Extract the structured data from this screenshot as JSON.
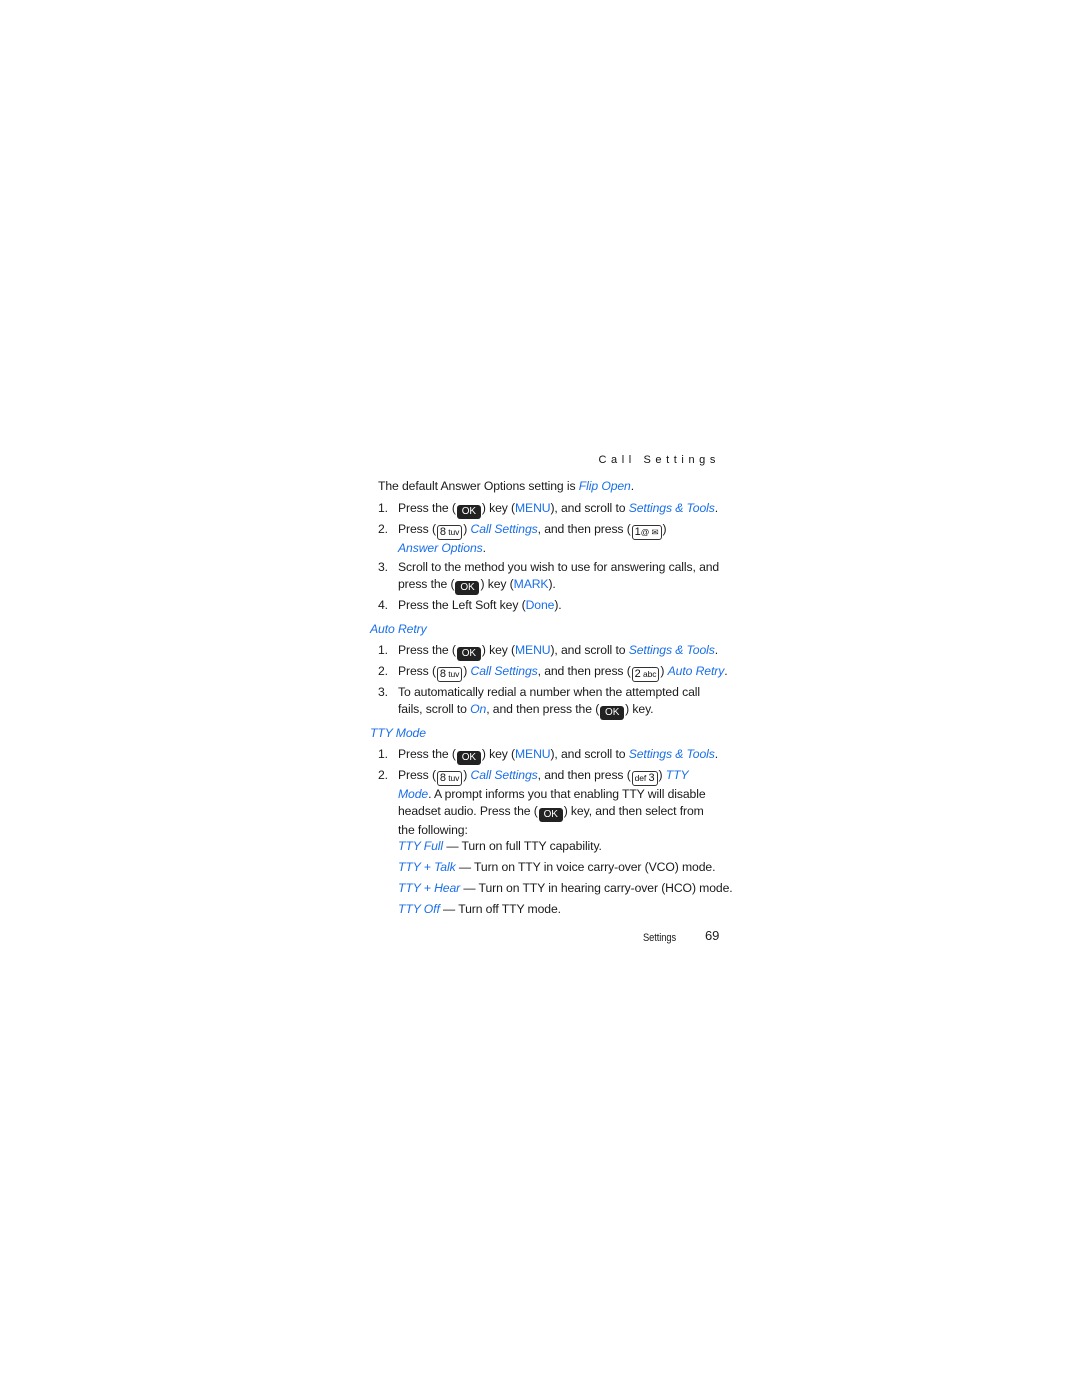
{
  "running_head": "Call Settings",
  "intro": {
    "text": "The default Answer Options setting is ",
    "value": "Flip Open",
    "end": "."
  },
  "keys": {
    "ok": "OK",
    "key8": {
      "digit": "8",
      "letters": "tuv"
    },
    "key1": {
      "digit": "1",
      "letters": "@ ✉"
    },
    "key2": {
      "digit": "2",
      "letters": "abc"
    },
    "key3": {
      "digit": "3",
      "letters": "def"
    }
  },
  "answer_steps": {
    "s1": {
      "num": "1.",
      "a": "Press the (",
      "b": ") key (",
      "menu": "MENU",
      "c": "), and scroll to ",
      "target": "Settings & Tools",
      "d": "."
    },
    "s2": {
      "num": "2.",
      "a": "Press (",
      "b": ") ",
      "link": "Call Settings",
      "c": ", and then press (",
      "d": ")",
      "target": "Answer Options",
      "e": "."
    },
    "s3": {
      "num": "3.",
      "a": "Scroll to the method you wish to use for answering calls, and press the (",
      "b": ") key (",
      "mark": "MARK",
      "c": ")."
    },
    "s4": {
      "num": "4.",
      "a": "Press the Left Soft key (",
      "done": "Done",
      "b": ")."
    }
  },
  "auto_retry": {
    "title": "Auto Retry",
    "s1": {
      "num": "1.",
      "a": "Press the (",
      "b": ") key (",
      "menu": "MENU",
      "c": "), and scroll to ",
      "target": "Settings & Tools",
      "d": "."
    },
    "s2": {
      "num": "2.",
      "a": "Press (",
      "b": ") ",
      "link": "Call Settings",
      "c": ", and then press (",
      "d": ") ",
      "target": "Auto Retry",
      "e": "."
    },
    "s3": {
      "num": "3.",
      "a": "To automatically redial a number when the attempted call fails, scroll to ",
      "on": "On",
      "b": ", and then press the (",
      "c": ") key."
    }
  },
  "tty_mode": {
    "title": "TTY Mode",
    "s1": {
      "num": "1.",
      "a": "Press the (",
      "b": ") key (",
      "menu": "MENU",
      "c": "), and scroll to ",
      "target": "Settings & Tools",
      "d": "."
    },
    "s2": {
      "num": "2.",
      "a": "Press (",
      "b": ") ",
      "link": "Call Settings",
      "c": ", and then press (",
      "d": ") ",
      "target": "TTY Mode",
      "e": ". A prompt informs you that enabling TTY will disable headset audio. Press the (",
      "f": ") key, and then select from the following:"
    },
    "options": [
      {
        "name": "TTY Full",
        "desc": " — Turn on full TTY capability."
      },
      {
        "name": "TTY + Talk",
        "desc": " — Turn on TTY in voice carry-over (VCO) mode."
      },
      {
        "name": "TTY + Hear",
        "desc": " — Turn on TTY in hearing carry-over (HCO) mode."
      },
      {
        "name": "TTY Off",
        "desc": " — Turn off TTY mode."
      }
    ]
  },
  "footer": {
    "section": "Settings",
    "page": "69"
  },
  "colors": {
    "link_blue": "#1a6fe8",
    "text": "#1a1a1a",
    "key_bg": "#222222"
  }
}
